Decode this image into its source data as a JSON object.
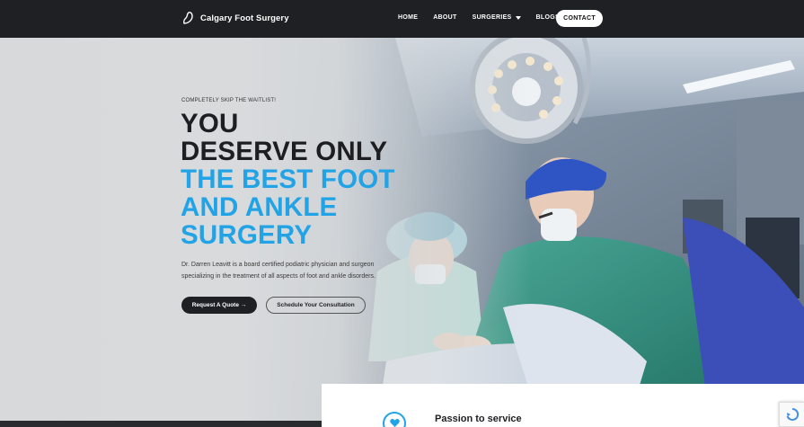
{
  "header": {
    "brand_name": "Calgary Foot Surgery",
    "nav": {
      "home": "HOME",
      "about": "ABOUT",
      "surgeries": "SURGERIES",
      "blogs": "BLOGS",
      "contact": "CONTACT"
    }
  },
  "hero": {
    "eyebrow": "COMPLETELY SKIP THE WAITLIST!",
    "headline_line1": "YOU",
    "headline_line2": "DESERVE ONLY",
    "headline_line3": "THE BEST FOOT",
    "headline_line4": "AND ANKLE",
    "headline_line5": "SURGERY",
    "description": "Dr. Darren Leavitt is a board certified podiatric physician and surgeon specializing in the treatment of all aspects of foot and ankle disorders.",
    "btn_quote": "Request A Quote →",
    "btn_consult": "Schedule Your Consultation"
  },
  "feature": {
    "title": "Passion to service",
    "icon": "heart-icon"
  },
  "colors": {
    "dark": "#1f2023",
    "accent": "#22a3e6",
    "scrubs": "#2f8f7e"
  }
}
